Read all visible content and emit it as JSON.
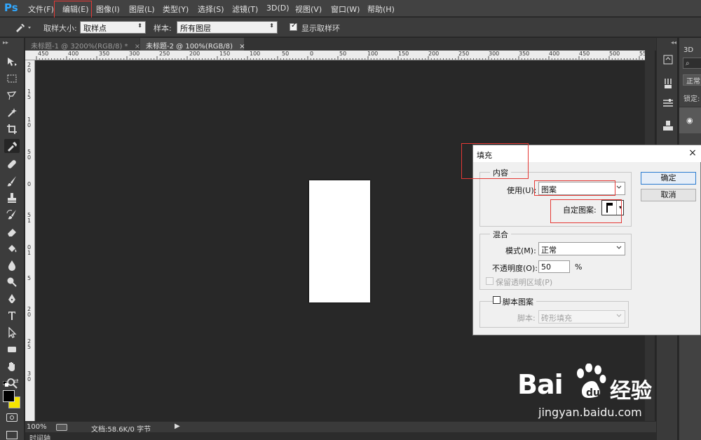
{
  "app": {
    "logo": "Ps",
    "menu": [
      "文件(F)",
      "编辑(E)",
      "图像(I)",
      "图层(L)",
      "类型(Y)",
      "选择(S)",
      "滤镜(T)",
      "3D(D)",
      "视图(V)",
      "窗口(W)",
      "帮助(H)"
    ]
  },
  "options_bar": {
    "tool_icon": "eyedropper-icon",
    "sample_size_label": "取样大小:",
    "sample_size_value": "取样点",
    "sample_label": "样本:",
    "sample_value": "所有图层",
    "show_ring_label": "显示取样环",
    "show_ring_checked": true
  },
  "tabs": [
    {
      "label": "未标题-1 @ 3200%(RGB/8) *",
      "close": "×",
      "active": false
    },
    {
      "label": "未标题-2 @ 100%(RGB/8)",
      "close": "×",
      "active": true
    }
  ],
  "ruler": {
    "top_labels": [
      "450",
      "400",
      "350",
      "300",
      "250",
      "200",
      "150",
      "100",
      "50",
      "0",
      "50",
      "100",
      "150",
      "200",
      "250",
      "300",
      "350",
      "400",
      "450",
      "500",
      "550"
    ],
    "left_labels": [
      "2",
      "0",
      "1",
      "5",
      "1",
      "0",
      "5",
      "0",
      "0",
      "5",
      "1",
      "0",
      "1",
      "5",
      "2",
      "0",
      "2",
      "5",
      "3",
      "0"
    ]
  },
  "status_bar": {
    "zoom": "100%",
    "doc_info": "文档:58.6K/0 字节",
    "timeline": "时间轴"
  },
  "right_panel": {
    "tab_3d": "3D",
    "blend_mode_partial": "正常",
    "lock_label_partial": "锁定:"
  },
  "dialog": {
    "title": "填充",
    "close": "×",
    "content_group": "内容",
    "use_label": "使用(U):",
    "use_value": "图案",
    "custom_pattern_label": "自定图案:",
    "blend_group": "混合",
    "mode_label": "模式(M):",
    "mode_value": "正常",
    "opacity_label": "不透明度(O):",
    "opacity_value": "50",
    "opacity_unit": "%",
    "preserve_transparency": "保留透明区域(P)",
    "script_pattern": "脚本图案",
    "script_label": "脚本:",
    "script_value": "砖形填充",
    "ok": "确定",
    "cancel": "取消"
  },
  "watermark": {
    "brand_latin": "Bai",
    "brand_latin2": "du",
    "brand_cn": "经验",
    "url": "jingyan.baidu.com"
  },
  "colors": {
    "accent_blue": "#31a8ff",
    "annotation_red": "#e53935",
    "foreground_swatch": "#000000",
    "background_swatch": "#f5e400"
  }
}
